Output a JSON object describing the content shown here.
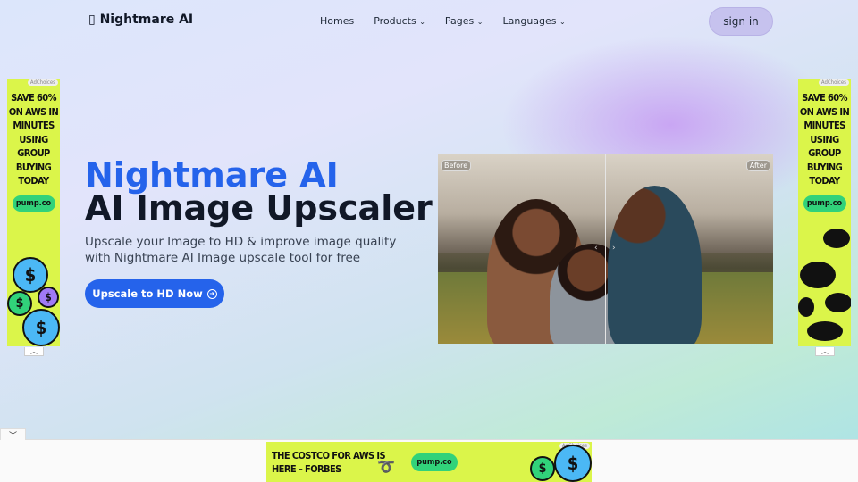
{
  "header": {
    "logo": "Nightmare AI",
    "logo_icon": "broken-image-icon",
    "nav": [
      {
        "label": "Homes"
      },
      {
        "label": "Products",
        "dropdown": true
      },
      {
        "label": "Pages",
        "dropdown": true
      },
      {
        "label": "Languages",
        "dropdown": true
      }
    ],
    "sign_in": "sign in"
  },
  "hero": {
    "title_accent": "Nightmare AI",
    "title": "AI Image Upscaler",
    "subtitle": "Upscale your Image to HD & improve image quality with Nightmare AI Image upscale tool for free",
    "cta": "Upscale to HD Now",
    "accent_color": "#2563eb"
  },
  "comparison": {
    "before_label": "Before",
    "after_label": "After"
  },
  "ads": {
    "side_text": "SAVE 60% ON AWS IN MINUTES USING GROUP BUYING TODAY",
    "brand": "pump.co",
    "adchoices": "AdChoices",
    "bottom_text": "THE COSTCO FOR AWS IS HERE – FORBES",
    "color": "#dbf54a",
    "coin_symbol": "$"
  }
}
